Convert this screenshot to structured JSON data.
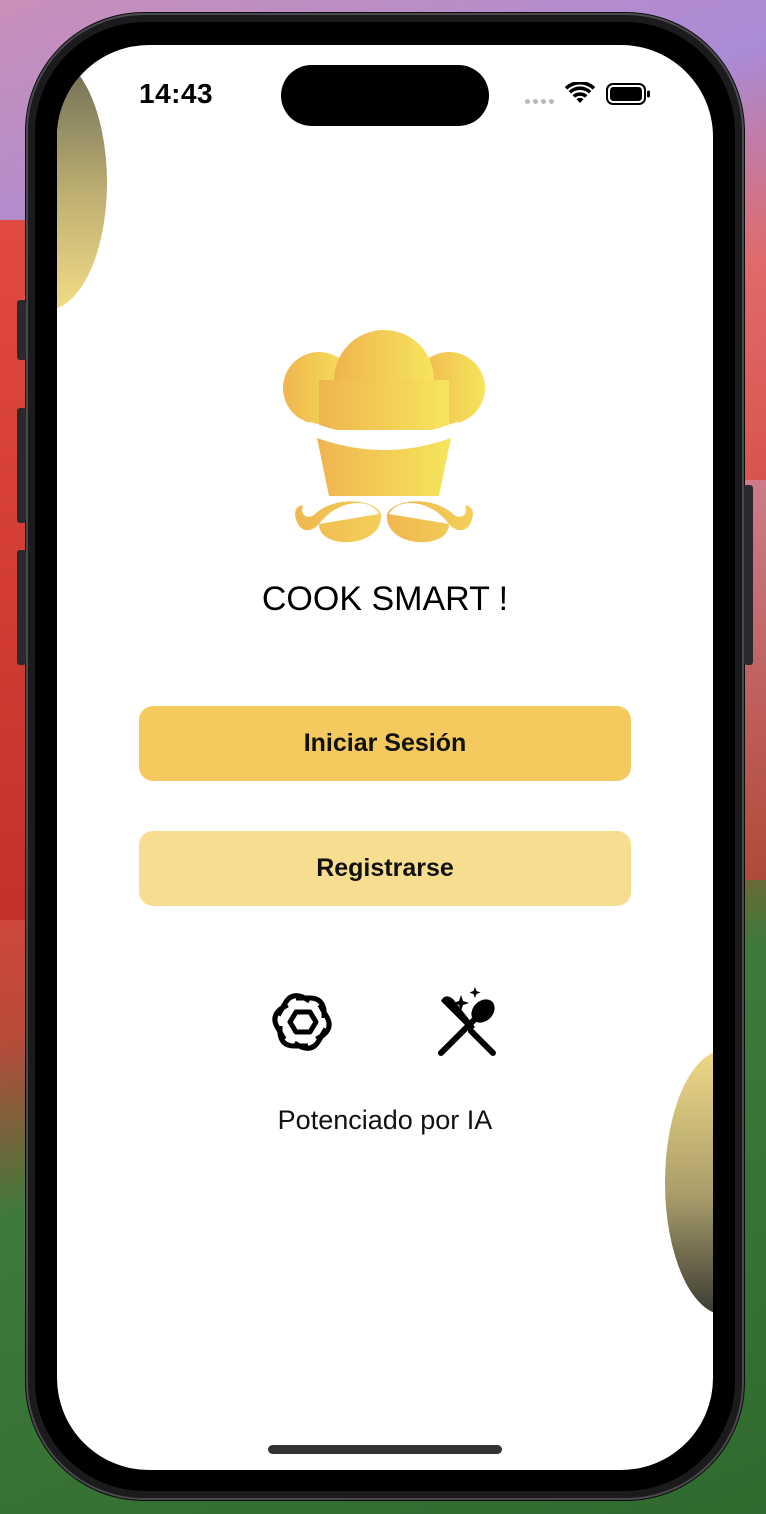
{
  "status_bar": {
    "time": "14:43"
  },
  "app": {
    "title": "COOK SMART !",
    "logo_icon": "chef-hat-mustache-icon"
  },
  "buttons": {
    "login_label": "Iniciar Sesión",
    "register_label": "Registrarse"
  },
  "footer": {
    "icons": [
      "openai-logo-icon",
      "utensils-sparkle-icon"
    ],
    "powered_label": "Potenciado por IA"
  },
  "colors": {
    "primary": "#f4c95e",
    "secondary": "#f7dd8f",
    "logo_gradient_start": "#efb44f",
    "logo_gradient_end": "#f6e55c"
  }
}
